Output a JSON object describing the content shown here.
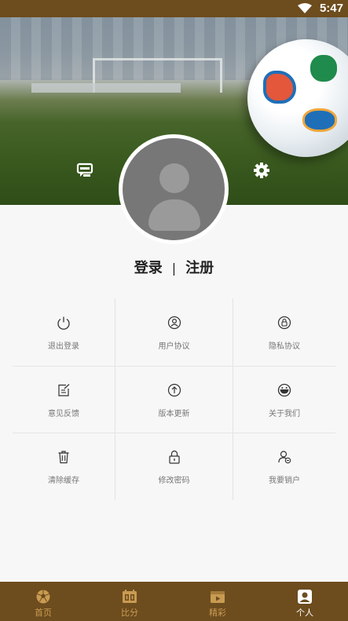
{
  "status": {
    "time": "5:47"
  },
  "auth": {
    "login": "登录",
    "separator": "|",
    "register": "注册"
  },
  "menu": [
    {
      "label": "退出登录",
      "icon": "power-icon"
    },
    {
      "label": "用户协议",
      "icon": "user-agreement-icon"
    },
    {
      "label": "隐私协议",
      "icon": "privacy-lock-icon"
    },
    {
      "label": "意见反馈",
      "icon": "feedback-edit-icon"
    },
    {
      "label": "版本更新",
      "icon": "update-arrow-icon"
    },
    {
      "label": "关于我们",
      "icon": "smile-icon"
    },
    {
      "label": "清除缓存",
      "icon": "trash-icon"
    },
    {
      "label": "修改密码",
      "icon": "padlock-icon"
    },
    {
      "label": "我要销户",
      "icon": "account-cancel-icon"
    }
  ],
  "tabs": [
    {
      "label": "首页",
      "icon": "soccer-ball-icon"
    },
    {
      "label": "比分",
      "icon": "scoreboard-icon"
    },
    {
      "label": "精彩",
      "icon": "video-icon"
    },
    {
      "label": "个人",
      "icon": "person-icon",
      "active": true
    }
  ],
  "colors": {
    "brand": "#6d4c1e",
    "tab_inactive": "#c99b52",
    "tab_active": "#ffffff"
  }
}
